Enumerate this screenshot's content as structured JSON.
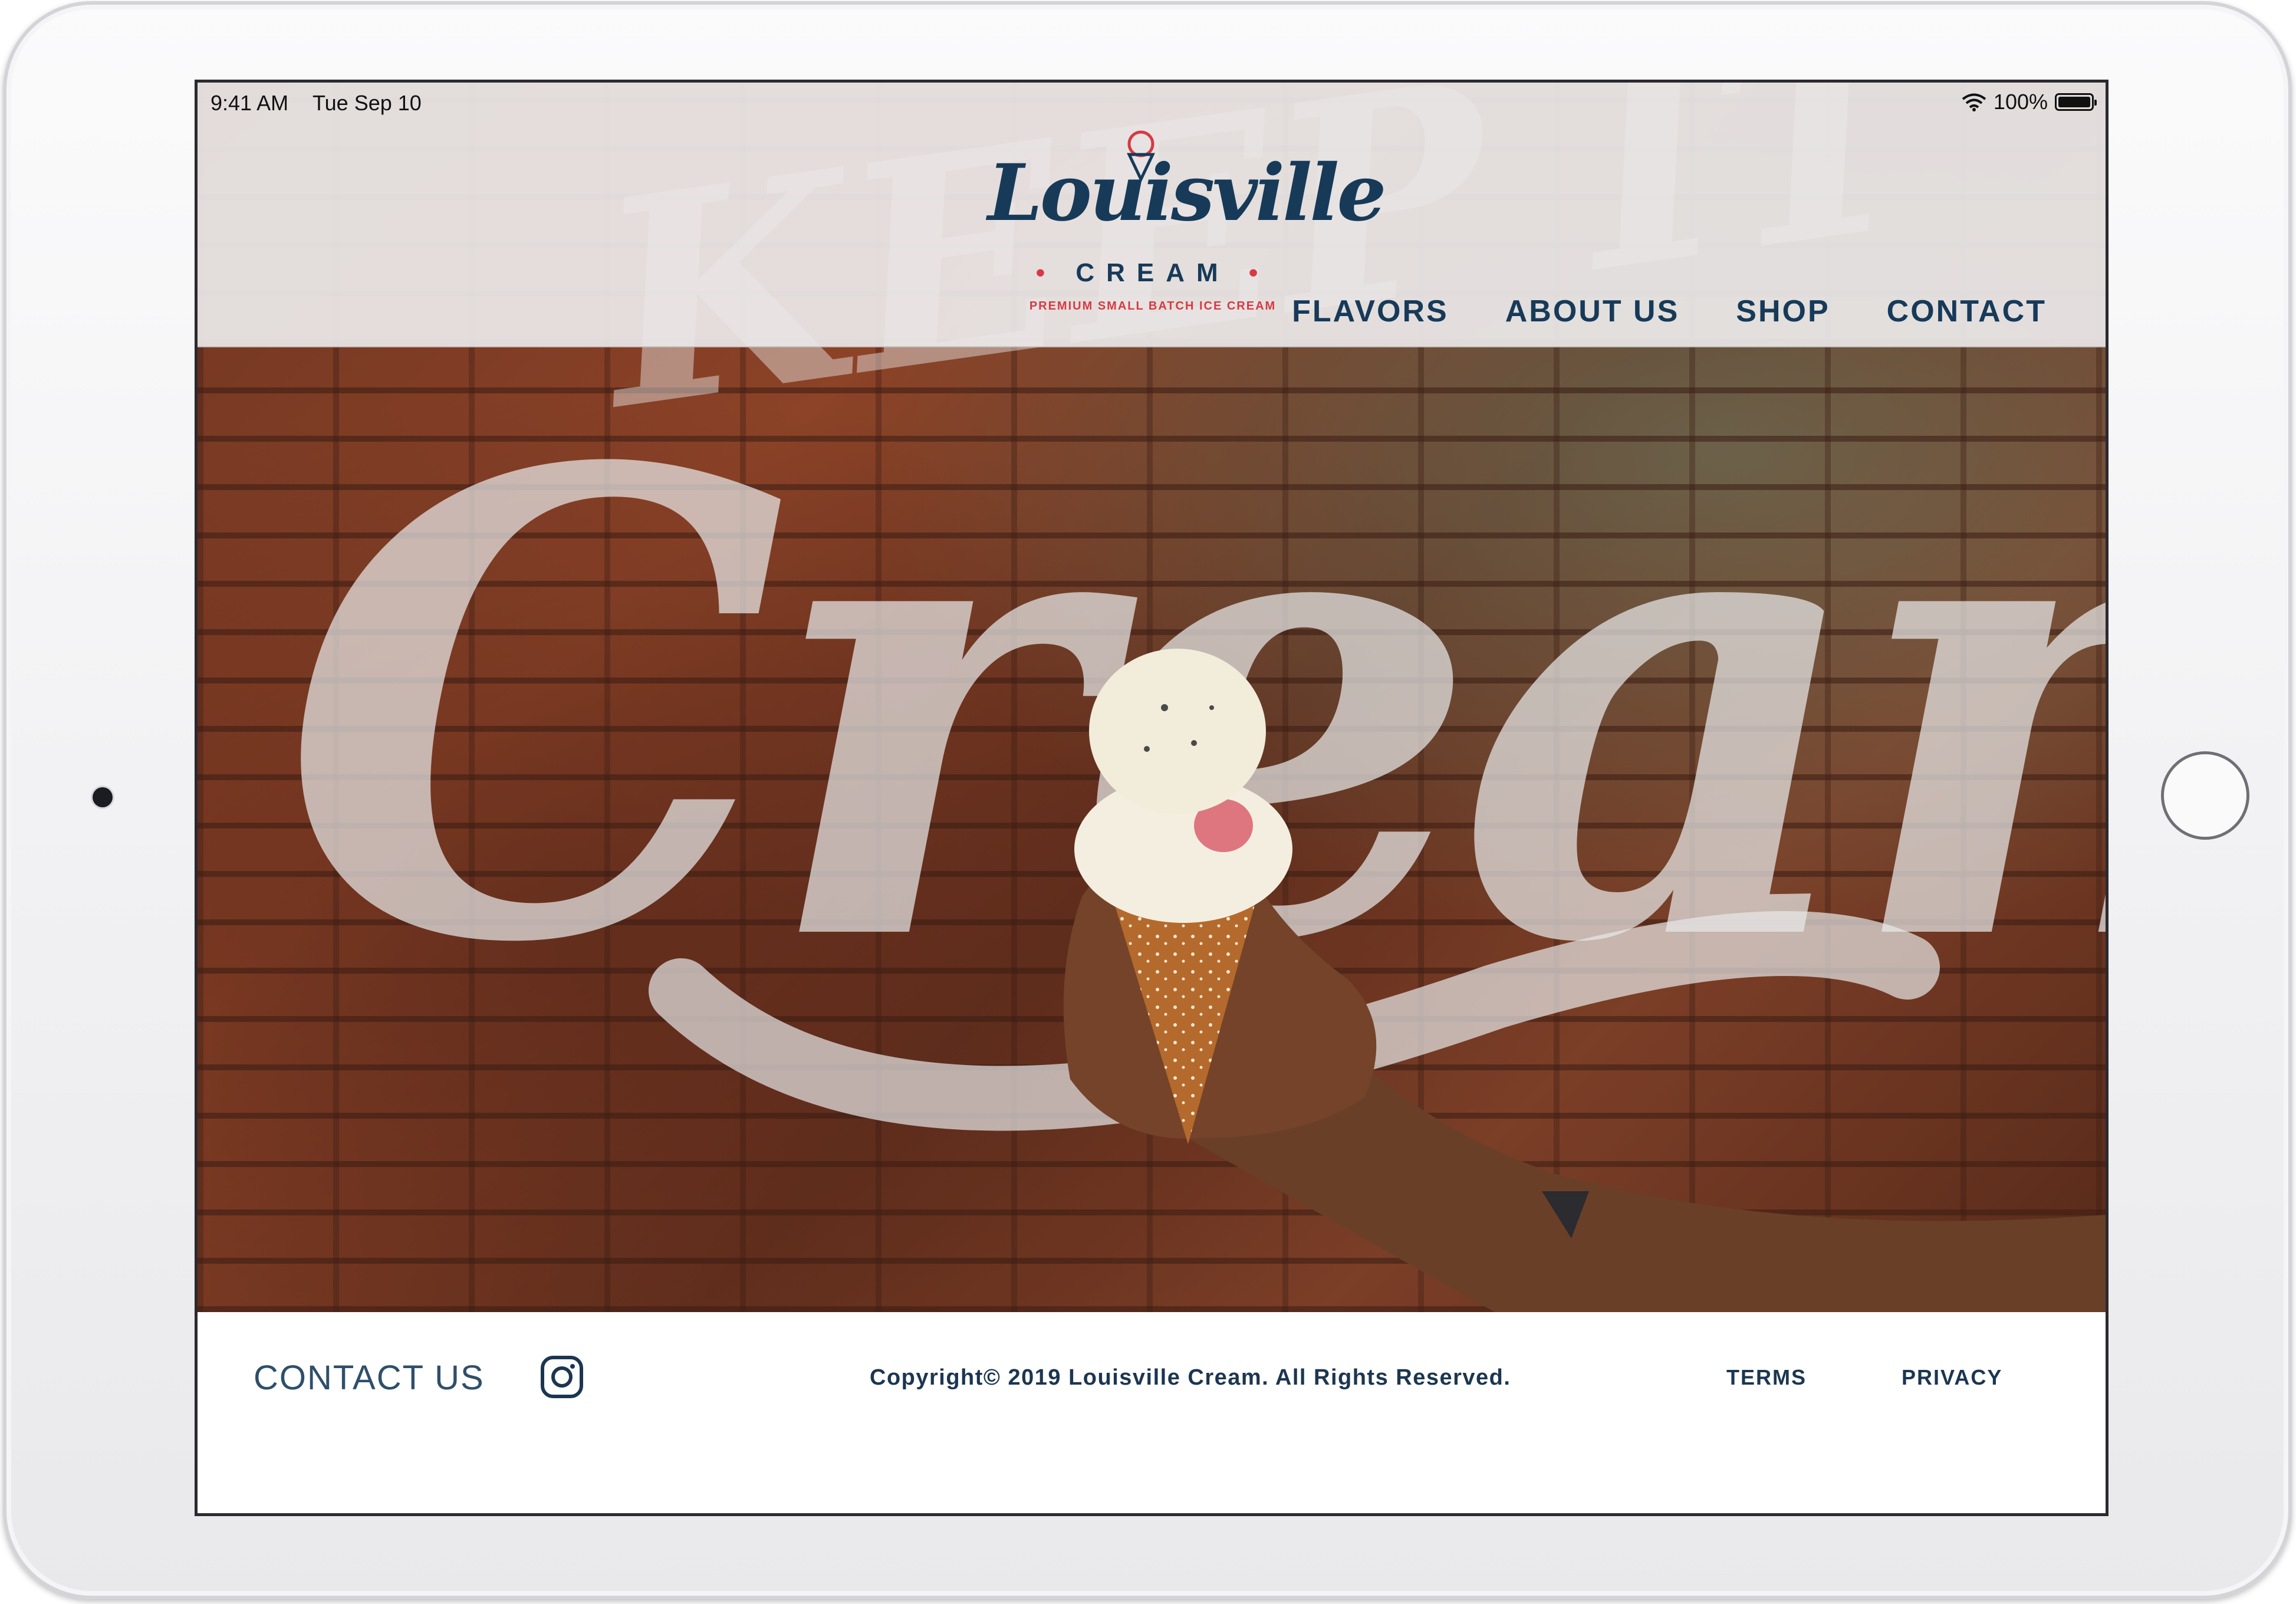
{
  "status_bar": {
    "time": "9:41 AM",
    "date": "Tue Sep 10",
    "battery": "100%",
    "battery_level": 1.0
  },
  "brand": {
    "logo_script": "Louisville",
    "logo_word": "CREAM",
    "tagline": "PREMIUM SMALL BATCH ICE CREAM",
    "navy": "#173a59",
    "red": "#d63a43"
  },
  "nav": {
    "items": [
      {
        "label": "FLAVORS"
      },
      {
        "label": "ABOUT US"
      },
      {
        "label": "SHOP"
      },
      {
        "label": "CONTACT"
      }
    ]
  },
  "hero": {
    "mural_text": "Creamy",
    "mural_text_top": "KEEP IT"
  },
  "footer": {
    "contact_label": "CONTACT US",
    "instagram_icon": "instagram-icon",
    "copyright": "Copyright© 2019 Louisville Cream. All Rights Reserved.",
    "terms_label": "TERMS",
    "privacy_label": "PRIVACY"
  }
}
